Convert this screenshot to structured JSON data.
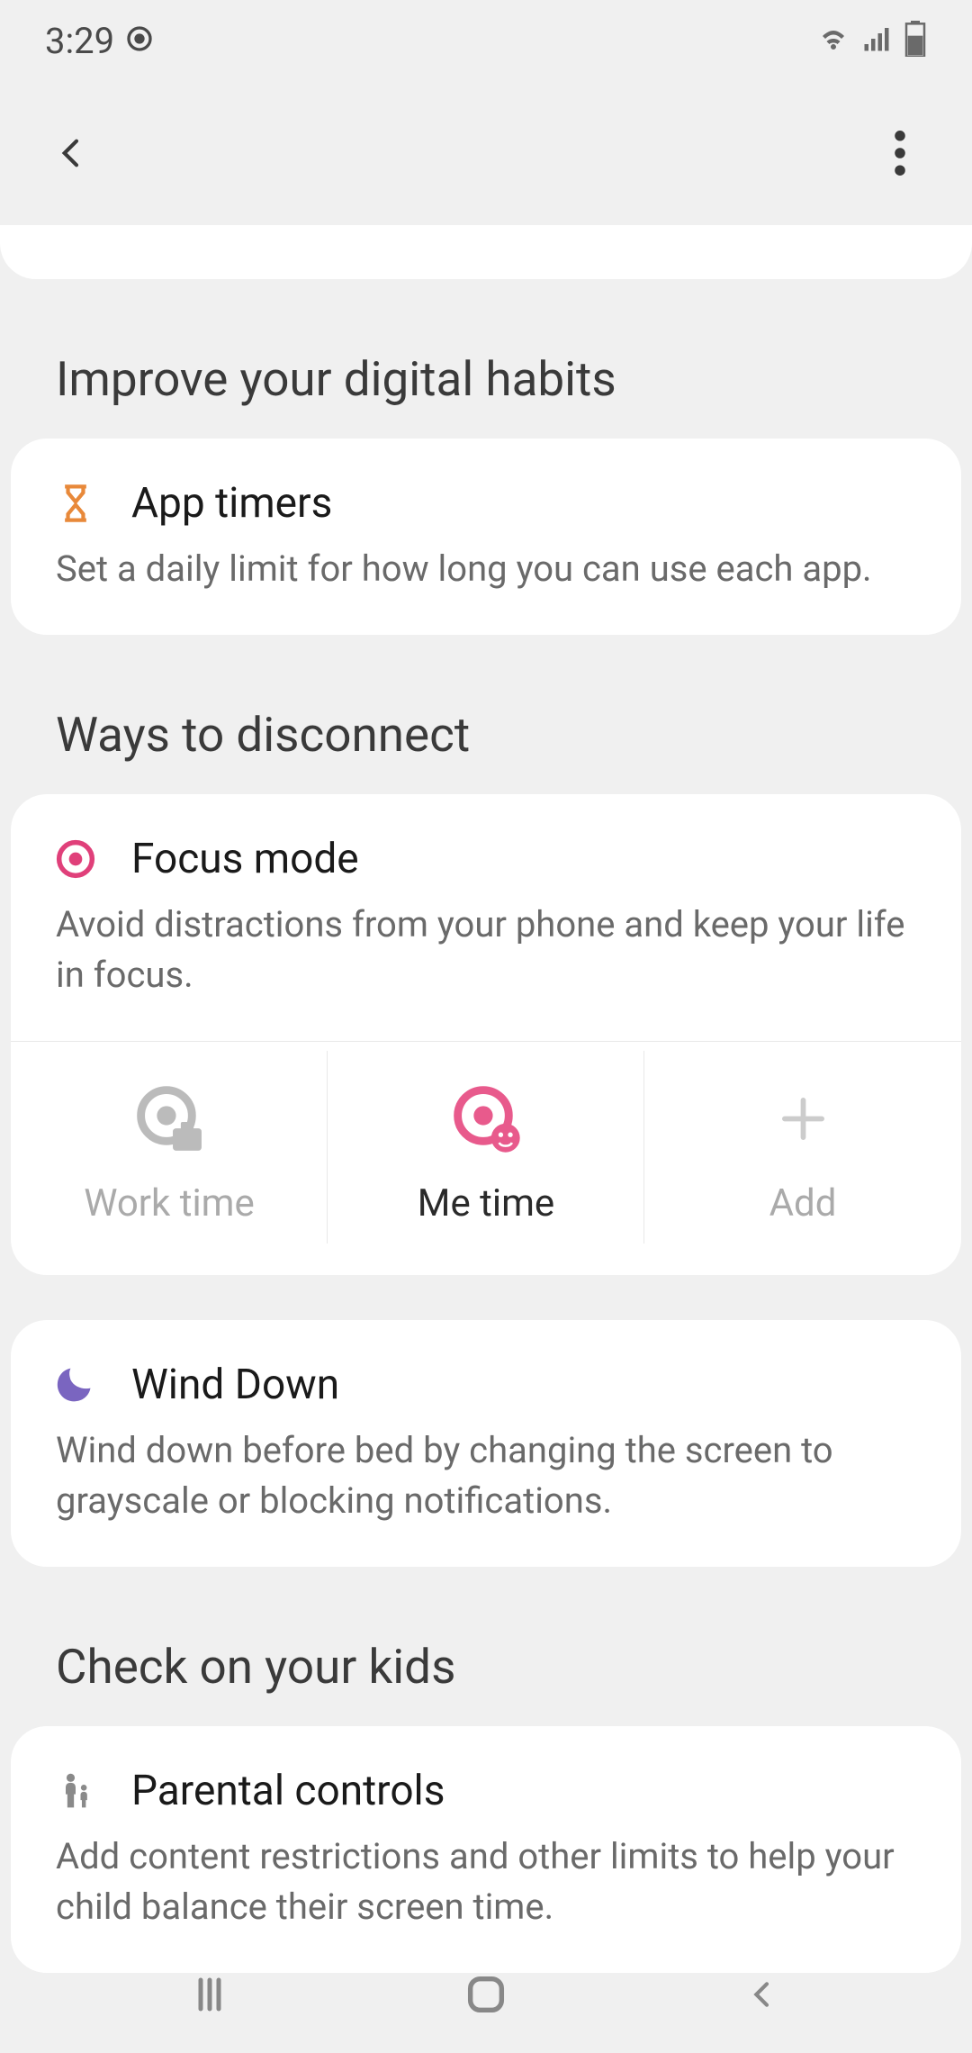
{
  "status": {
    "time": "3:29"
  },
  "sections": {
    "habits": {
      "title": "Improve your digital habits",
      "app_timers": {
        "title": "App timers",
        "desc": "Set a daily limit for how long you can use each app."
      }
    },
    "disconnect": {
      "title": "Ways to disconnect",
      "focus_mode": {
        "title": "Focus mode",
        "desc": "Avoid distractions from your phone and keep your life in focus.",
        "items": {
          "work": "Work time",
          "me": "Me time",
          "add": "Add"
        }
      },
      "wind_down": {
        "title": "Wind Down",
        "desc": "Wind down before bed by changing the screen to grayscale or blocking notifications."
      }
    },
    "kids": {
      "title": "Check on your kids",
      "parental": {
        "title": "Parental controls",
        "desc": "Add content restrictions and other limits to help your child balance their screen time."
      }
    }
  }
}
